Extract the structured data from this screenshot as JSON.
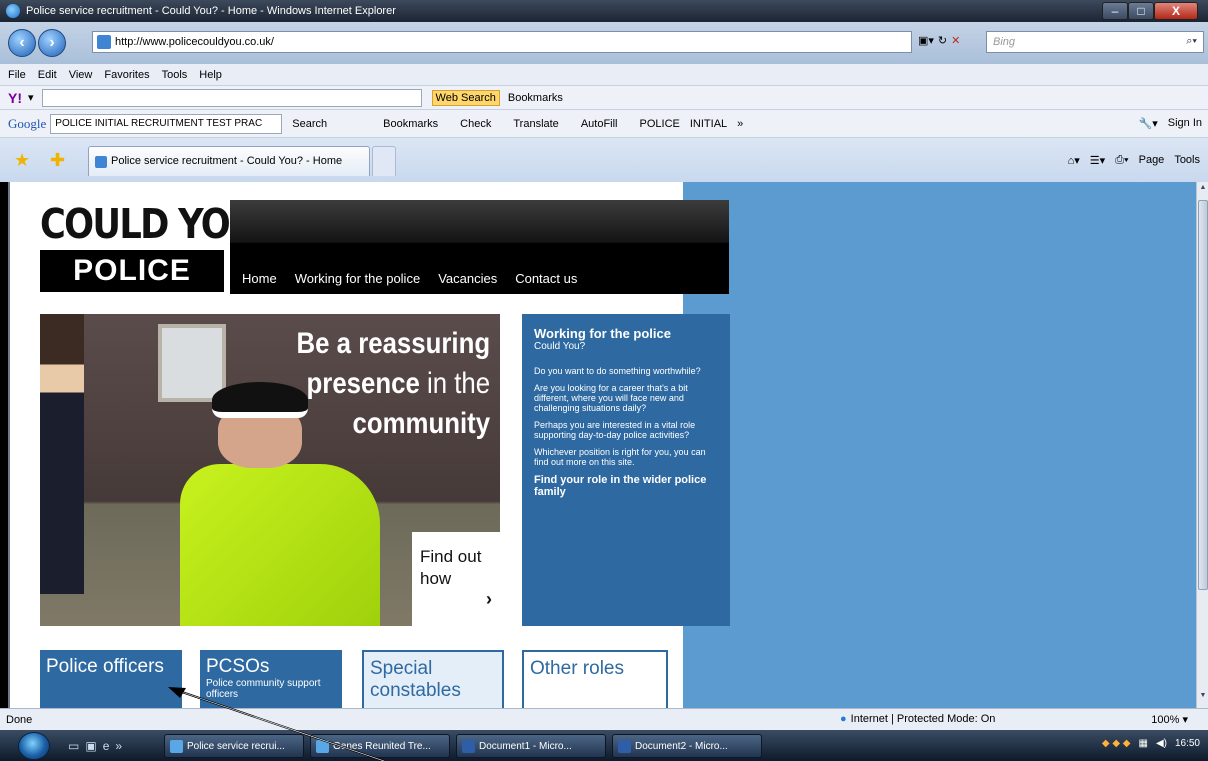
{
  "window": {
    "title": "Police service recruitment - Could You? - Home - Windows Internet Explorer",
    "minimize": "–",
    "maximize": "□",
    "close": "X"
  },
  "address": {
    "url": "http://www.policecouldyou.co.uk/",
    "search_placeholder": "Bing"
  },
  "menu": [
    "File",
    "Edit",
    "View",
    "Favorites",
    "Tools",
    "Help"
  ],
  "yahoo_toolbar": {
    "web_search": "Web Search",
    "bookmarks": "Bookmarks"
  },
  "google_toolbar": {
    "logo": "Google",
    "query": "POLICE INITIAL RECRUITMENT TEST PRAC",
    "search": "Search",
    "bookmarks": "Bookmarks",
    "check": "Check",
    "translate": "Translate",
    "autofill": "AutoFill",
    "police": "POLICE",
    "initial": "INITIAL",
    "more": "»",
    "sign_in": "Sign In"
  },
  "tab": {
    "title": "Police service recruitment - Could You? - Home"
  },
  "command_bar": {
    "page": "Page",
    "tools": "Tools"
  },
  "site": {
    "logo_line1": "COULD YOU?",
    "logo_line2": "POLICE",
    "nav": [
      "Home",
      "Working for the police",
      "Vacancies",
      "Contact us"
    ],
    "hero": {
      "line1_bold": "Be",
      "line1_rest": " a reassuring",
      "line2_bold": "presence",
      "line2_rest": " in the",
      "line3": "community",
      "cta_line1": "Find out",
      "cta_line2": "how",
      "cta_chevron": "›"
    },
    "panel": {
      "title": "Working for the police",
      "subtitle": "Could You?",
      "paragraphs": [
        "Do you want to do something worthwhile?",
        "Are you looking for a career that's a bit different, where you will face new and challenging situations daily?",
        "Perhaps you are interested in a vital role supporting day-to-day police activities?",
        "Whichever position is right for you, you can find out more on this site."
      ],
      "cta": "Find your role in the wider police family"
    },
    "roles": {
      "police_officers": "Police officers",
      "pcsos": "PCSOs",
      "pcsos_sub": "Police community support officers",
      "special_constables": "Special constables",
      "other_roles": "Other roles"
    }
  },
  "status": {
    "left": "Done",
    "zone": "Internet | Protected Mode: On",
    "zoom": "100%"
  },
  "taskbar": {
    "items": [
      "Police service recrui...",
      "Genes Reunited Tre...",
      "Document1 - Micro...",
      "Document2 - Micro..."
    ],
    "clock": "16:50"
  }
}
